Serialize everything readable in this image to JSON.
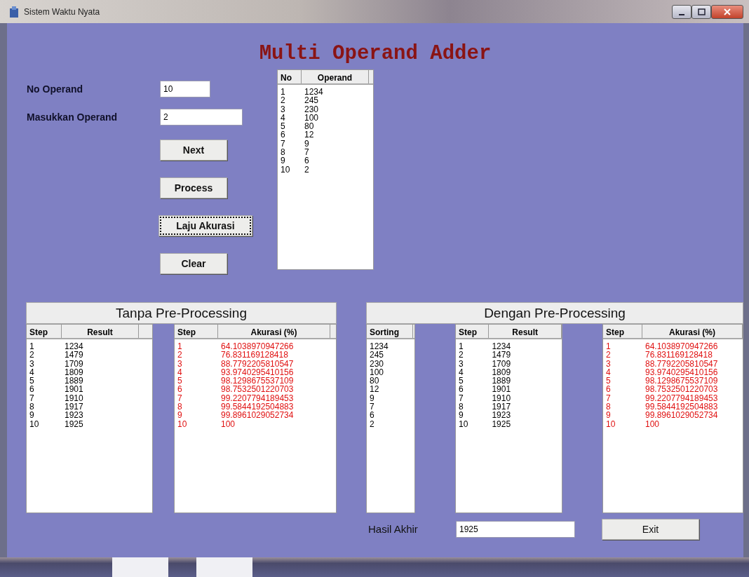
{
  "window": {
    "title": "Sistem Waktu Nyata"
  },
  "heading": "Multi Operand Adder",
  "fields": [
    {
      "label": "No Operand",
      "value": "10"
    },
    {
      "label": "Masukkan Operand",
      "value": "2"
    }
  ],
  "buttons": [
    {
      "label": "Next",
      "focused": false
    },
    {
      "label": "Process",
      "focused": false
    },
    {
      "label": "Laju Akurasi",
      "focused": true
    },
    {
      "label": "Clear",
      "focused": false
    }
  ],
  "operand_list": {
    "columns": [
      "No",
      "Operand"
    ],
    "rows": [
      [
        "1",
        "1234"
      ],
      [
        "2",
        "245"
      ],
      [
        "3",
        "230"
      ],
      [
        "4",
        "100"
      ],
      [
        "5",
        "80"
      ],
      [
        "6",
        "12"
      ],
      [
        "7",
        "9"
      ],
      [
        "8",
        "7"
      ],
      [
        "9",
        "6"
      ],
      [
        "10",
        "2"
      ]
    ]
  },
  "panels": [
    {
      "title": "Tanpa Pre-Processing",
      "lists": [
        {
          "kind": "result",
          "columns": [
            "Step",
            "Result"
          ],
          "rows": [
            [
              "1",
              "1234"
            ],
            [
              "2",
              "1479"
            ],
            [
              "3",
              "1709"
            ],
            [
              "4",
              "1809"
            ],
            [
              "5",
              "1889"
            ],
            [
              "6",
              "1901"
            ],
            [
              "7",
              "1910"
            ],
            [
              "8",
              "1917"
            ],
            [
              "9",
              "1923"
            ],
            [
              "10",
              "1925"
            ]
          ]
        },
        {
          "kind": "accuracy",
          "columns": [
            "Step",
            "Akurasi (%)"
          ],
          "rows": [
            [
              "1",
              "64.1038970947266"
            ],
            [
              "2",
              "76.831169128418"
            ],
            [
              "3",
              "88.7792205810547"
            ],
            [
              "4",
              "93.9740295410156"
            ],
            [
              "5",
              "98.1298675537109"
            ],
            [
              "6",
              "98.7532501220703"
            ],
            [
              "7",
              "99.2207794189453"
            ],
            [
              "8",
              "99.5844192504883"
            ],
            [
              "9",
              "99.8961029052734"
            ],
            [
              "10",
              "100"
            ]
          ]
        }
      ]
    },
    {
      "title": "Dengan Pre-Processing",
      "lists": [
        {
          "kind": "sorting",
          "columns": [
            "Sorting"
          ],
          "rows": [
            [
              "1234"
            ],
            [
              "245"
            ],
            [
              "230"
            ],
            [
              "100"
            ],
            [
              "80"
            ],
            [
              "12"
            ],
            [
              "9"
            ],
            [
              "7"
            ],
            [
              "6"
            ],
            [
              "2"
            ]
          ]
        },
        {
          "kind": "result",
          "columns": [
            "Step",
            "Result"
          ],
          "rows": [
            [
              "1",
              "1234"
            ],
            [
              "2",
              "1479"
            ],
            [
              "3",
              "1709"
            ],
            [
              "4",
              "1809"
            ],
            [
              "5",
              "1889"
            ],
            [
              "6",
              "1901"
            ],
            [
              "7",
              "1910"
            ],
            [
              "8",
              "1917"
            ],
            [
              "9",
              "1923"
            ],
            [
              "10",
              "1925"
            ]
          ]
        },
        {
          "kind": "accuracy",
          "columns": [
            "Step",
            "Akurasi (%)"
          ],
          "rows": [
            [
              "1",
              "64.1038970947266"
            ],
            [
              "2",
              "76.831169128418"
            ],
            [
              "3",
              "88.7792205810547"
            ],
            [
              "4",
              "93.9740295410156"
            ],
            [
              "5",
              "98.1298675537109"
            ],
            [
              "6",
              "98.7532501220703"
            ],
            [
              "7",
              "99.2207794189453"
            ],
            [
              "8",
              "99.5844192504883"
            ],
            [
              "9",
              "99.8961029052734"
            ],
            [
              "10",
              "100"
            ]
          ]
        }
      ]
    }
  ],
  "final": {
    "label": "Hasil Akhir",
    "value": "1925"
  },
  "exit_button": "Exit"
}
